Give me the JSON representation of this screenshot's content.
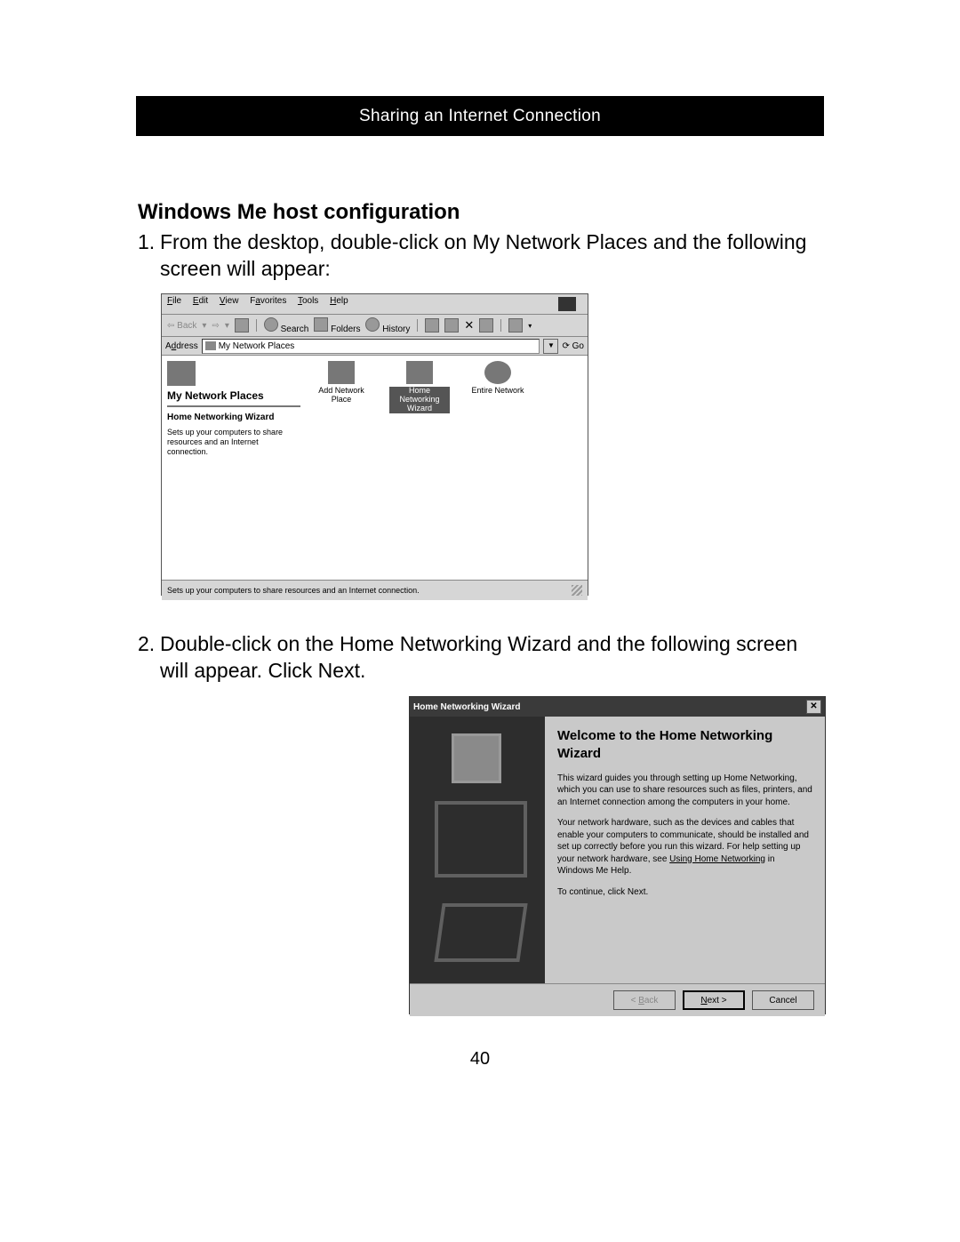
{
  "page": {
    "banner": "Sharing an Internet Connection",
    "heading": "Windows Me host configuration",
    "step1": "From the desktop, double-click on My Network Places and the following screen will appear:",
    "step2": "Double-click on the Home Networking Wizard and the following screen will appear. Click Next.",
    "number": "40"
  },
  "explorer": {
    "menu": {
      "file": "File",
      "edit": "Edit",
      "view": "View",
      "favorites": "Favorites",
      "tools": "Tools",
      "help": "Help"
    },
    "toolbar": {
      "back": "Back",
      "search": "Search",
      "folders": "Folders",
      "history": "History"
    },
    "address": {
      "label": "Address",
      "value": "My Network Places",
      "go": "Go"
    },
    "leftpane": {
      "title": "My Network Places",
      "subtitle": "Home Networking Wizard",
      "desc": "Sets up your computers to share resources and an Internet connection."
    },
    "icons": [
      {
        "label": "Add Network Place"
      },
      {
        "label": "Home Networking Wizard"
      },
      {
        "label": "Entire Network"
      }
    ],
    "status": "Sets up your computers to share resources and an Internet connection."
  },
  "wizard": {
    "title": "Home Networking Wizard",
    "heading": "Welcome to the Home Networking Wizard",
    "p1": "This wizard guides you through setting up Home Networking, which you can use to share resources such as files, printers, and an Internet connection among the computers in your home.",
    "p2a": "Your network hardware, such as the devices and cables that enable your computers to communicate, should be installed and set up correctly before you run this wizard. For help setting up your network hardware, see ",
    "p2link": "Using Home Networking",
    "p2b": " in Windows Me Help.",
    "p3": "To continue, click Next.",
    "buttons": {
      "back": "< Back",
      "next": "Next >",
      "cancel": "Cancel"
    }
  }
}
